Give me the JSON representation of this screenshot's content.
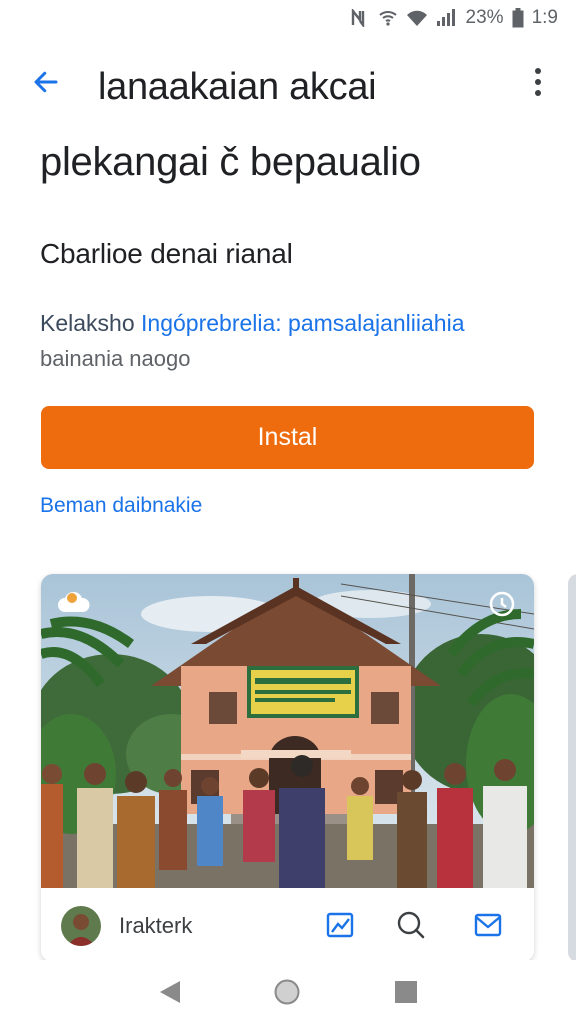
{
  "status_bar": {
    "battery_percent": "23%",
    "time": "1:9",
    "icons": [
      "nfc-icon",
      "wifi-calling-icon",
      "wifi-icon",
      "signal-icon",
      "battery-icon"
    ]
  },
  "app_bar": {
    "title_line1": "lanaakaian akcai",
    "back_icon": "arrow-left-icon",
    "more_icon": "more-vert-icon"
  },
  "title_line2": "plekangai č bepaualio",
  "subtitle": "Cbarlioe denai rianal",
  "info": {
    "developer_part1": "Kelaksho ",
    "developer_part2": "Ingóprebrelia: pamsalajanliiahia",
    "line2": "bainania naogo"
  },
  "install_button": {
    "label": "Instal"
  },
  "secondary_link": {
    "label": "Beman daibnakie"
  },
  "card": {
    "author": "Irakterk",
    "badge_top_left_icon": "cloud-icon",
    "badge_top_right_icon": "timer-icon",
    "footer_icons": [
      "image-edit-icon",
      "search-icon",
      "mail-icon"
    ]
  },
  "nav_bar": {
    "icons": [
      "back-triangle-icon",
      "home-circle-icon",
      "recents-square-icon"
    ]
  },
  "colors": {
    "accent_orange": "#ee6c0e",
    "link_blue": "#1a73e8",
    "text_primary": "#202124",
    "text_secondary": "#5f6368"
  }
}
